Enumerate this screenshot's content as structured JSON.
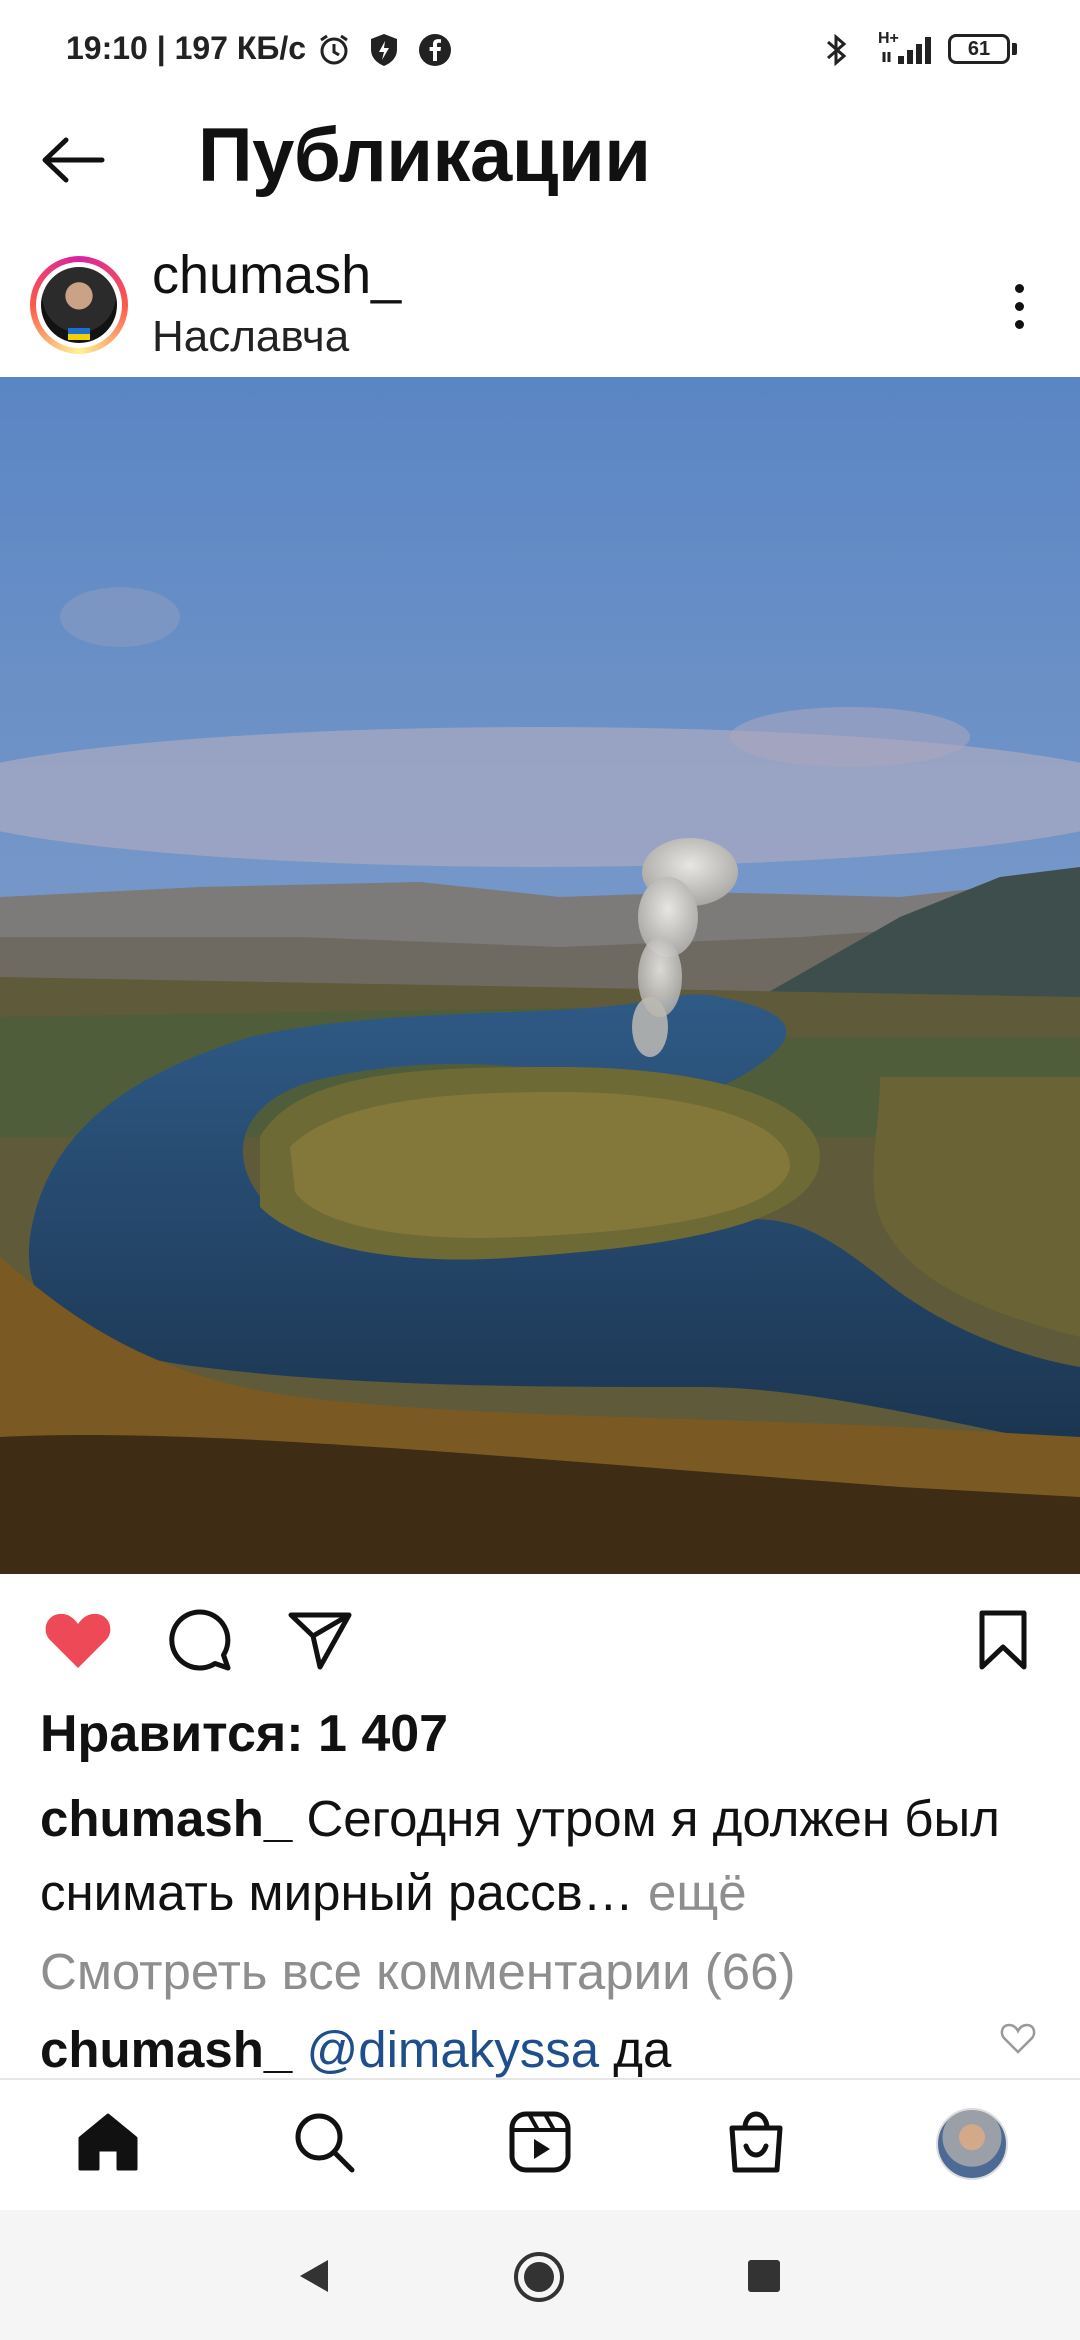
{
  "status_bar": {
    "time_speed": "19:10 | 197 КБ/с",
    "network": "H+",
    "battery": "61"
  },
  "header": {
    "back_icon": "arrow-left-icon",
    "title": "Публикации"
  },
  "post": {
    "username": "chumash_",
    "location": "Наславча",
    "more_icon": "more-vertical-icon",
    "image_description_icon": "river-landscape-photo",
    "actions": {
      "like_icon": "heart-filled-icon",
      "like_color": "#ed4956",
      "comment_icon": "comment-icon",
      "share_icon": "send-icon",
      "save_icon": "bookmark-icon"
    },
    "likes_text": "Нравится: 1 407",
    "caption_user": "chumash_",
    "caption_text": "Сегодня утром я должен был снимать мирный рассв…",
    "caption_more": "ещё",
    "view_comments": "Смотреть все комментарии (66)",
    "comment": {
      "user": "chumash_",
      "mention": "@dimakyssa",
      "text": "да"
    }
  },
  "bottom_nav": {
    "items": [
      {
        "icon": "home-icon"
      },
      {
        "icon": "search-icon"
      },
      {
        "icon": "reels-icon"
      },
      {
        "icon": "shop-icon"
      },
      {
        "icon": "profile-avatar-icon"
      }
    ]
  },
  "system_nav": {
    "back_icon": "triangle-back-icon",
    "home_icon": "circle-home-icon",
    "recents_icon": "square-recents-icon"
  }
}
